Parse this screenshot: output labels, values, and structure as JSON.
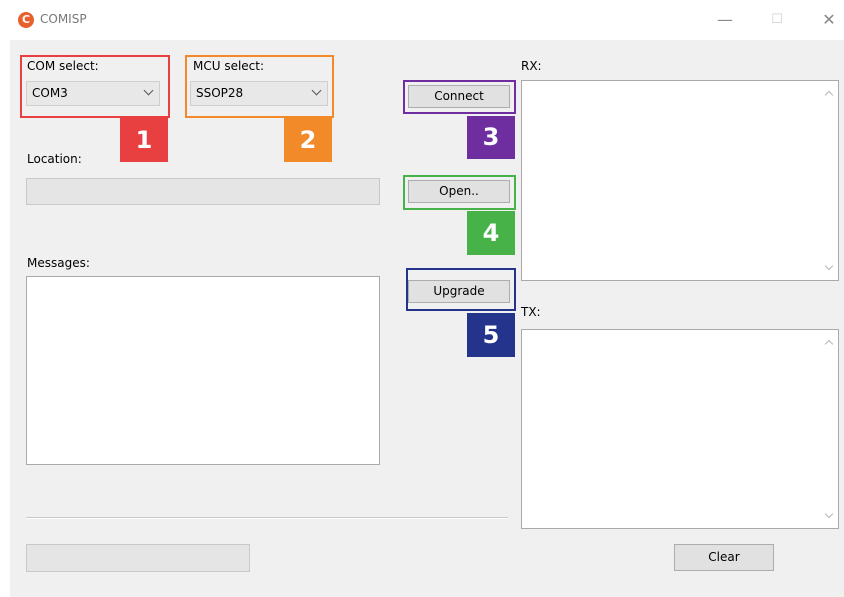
{
  "window": {
    "title": "COMISP",
    "icon_letter": "C",
    "controls": {
      "minimize": "—",
      "maximize": "☐",
      "close": "✕"
    }
  },
  "com": {
    "label": "COM select:",
    "value": "COM3"
  },
  "mcu": {
    "label": "MCU select:",
    "value": "SSOP28"
  },
  "location": {
    "label": "Location:",
    "value": ""
  },
  "messages": {
    "label": "Messages:"
  },
  "rx": {
    "label": "RX:"
  },
  "tx": {
    "label": "TX:"
  },
  "buttons": {
    "connect": "Connect",
    "open": "Open..",
    "upgrade": "Upgrade",
    "clear": "Clear"
  },
  "badges": [
    "1",
    "2",
    "3",
    "4",
    "5"
  ],
  "colors": {
    "badge1": "#e84040",
    "badge2": "#f38a2a",
    "badge3": "#6e2ea0",
    "badge4": "#47b247",
    "badge5": "#24338c"
  }
}
